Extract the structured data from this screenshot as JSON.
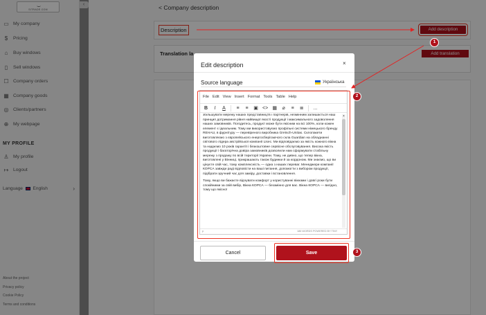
{
  "sidebar": {
    "logo_text": "SITRADE.COM",
    "collapse_glyph": "‹",
    "items": [
      {
        "label": "My company",
        "icon": "building-icon"
      },
      {
        "label": "Pricing",
        "icon": "dollar-icon"
      },
      {
        "label": "Buy windows",
        "icon": "cart-icon"
      },
      {
        "label": "Sell windows",
        "icon": "sell-icon"
      },
      {
        "label": "Company orders",
        "icon": "orders-icon"
      },
      {
        "label": "Company goods",
        "icon": "goods-icon"
      },
      {
        "label": "Clients/partners",
        "icon": "clients-icon"
      },
      {
        "label": "My webpage",
        "icon": "globe-icon"
      }
    ],
    "profile_title": "MY PROFILE",
    "profile_items": [
      {
        "label": "My profile",
        "icon": "user-icon"
      },
      {
        "label": "Logout",
        "icon": "logout-icon"
      }
    ],
    "language_label": "Language",
    "language_value": "English",
    "footer": [
      "About the project",
      "Privacy policy",
      "Cookie Policy",
      "Terms and conditions"
    ]
  },
  "main": {
    "back_title": "< Company description",
    "description_label": "Description",
    "add_description": "Add description",
    "translation_label": "Translation la",
    "add_translation": "Add translation"
  },
  "modal": {
    "title": "Edit description",
    "close": "×",
    "source_language_label": "Source language",
    "language": "Українська",
    "menu": [
      "File",
      "Edit",
      "View",
      "Insert",
      "Format",
      "Tools",
      "Table",
      "Help"
    ],
    "toolbar": [
      "B",
      "I",
      "A",
      "≡",
      "≡",
      "▣",
      "<>",
      "▦",
      "⌀",
      "≡",
      "≣",
      "..."
    ],
    "body_paragraphs": [
      "збільшувати мережу наших представництв і партнерів, незмінним залишається наш принцип дотримання рівня найвищої якості продукції і максимального задоволення наших замовників. Погодитесь, продукт може бути якісним на всі 100%, коли кожен елемент є ідеальним. Тому ми використовуємо профільні системи німецького бренду REHAU, в фурнітуру — перевіреного виробника Gretsch-Unitas. Склопакети виготовляємо з європейського енергосберігаючого скла Guardian на обладнанні світового лідера австрійської компанії Lisec. Ми відповідаємо за якість кожного вікна та надаємо 10 років гарантії і безкоштовне сервісне обслуговування. Висока якість продукції і багаторічна довіра замовників дозволили нам сформувати стабільну мережу з продажу по всій території України. Тому, не дивно, що тепер вікна, виготовлені у Вінниці, прикрашають також будинки й за кордоном. Ми знаємо, що ви цінуєте свій час, тому комплексність — одна з наших переваг. Менеджери компанії КОРСА завжди раді відповісти на ваші питання, допомогти з вибором продукції, підібрати зручний час для заміру, доставки і встановлення.",
      "Тому, якщо ви бажаєте відчувати комфорт у користуванні вікнами і довгі роки бути спокійними за свій вибір, Вікна КОРСА — беззмінно для вас. Вікна КОРСА — вигідно, тому що якісно!"
    ],
    "status_path": "p",
    "status_count": "186 WORDS  POWERED BY TINY",
    "cancel": "Cancel",
    "save": "Save"
  },
  "badges": [
    "1",
    "2",
    "3"
  ],
  "colors": {
    "accent": "#b0121c",
    "highlight": "#e32222"
  }
}
